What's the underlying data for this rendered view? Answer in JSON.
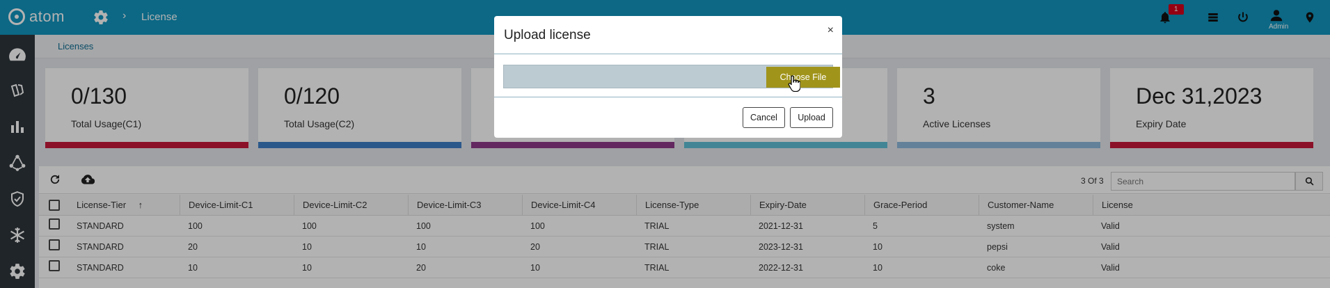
{
  "app": {
    "name": "atom",
    "breadcrumb": "License"
  },
  "topbar": {
    "notification_count": "1",
    "admin_label": "Admin"
  },
  "subheader": {
    "breadcrumb": "Licenses"
  },
  "cards": [
    {
      "value": "0/130",
      "label": "Total Usage(C1)",
      "color": "#c8193c"
    },
    {
      "value": "0/120",
      "label": "Total Usage(C2)",
      "color": "#3e7fc7"
    },
    {
      "value": "",
      "label": "",
      "color": "#8e3a89"
    },
    {
      "value": "",
      "label": "",
      "color": "#5fc0d6"
    },
    {
      "value": "3",
      "label": "Active Licenses",
      "color": "#8fb9dc"
    },
    {
      "value": "Dec 31,2023",
      "label": "Expiry Date",
      "color": "#c8193c"
    }
  ],
  "table": {
    "count": "3 Of 3",
    "search_placeholder": "Search",
    "columns": [
      "License-Tier",
      "Device-Limit-C1",
      "Device-Limit-C2",
      "Device-Limit-C3",
      "Device-Limit-C4",
      "License-Type",
      "Expiry-Date",
      "Grace-Period",
      "Customer-Name",
      "License"
    ],
    "rows": [
      [
        "STANDARD",
        "100",
        "100",
        "100",
        "100",
        "TRIAL",
        "2021-12-31",
        "5",
        "system",
        "Valid"
      ],
      [
        "STANDARD",
        "20",
        "10",
        "10",
        "20",
        "TRIAL",
        "2023-12-31",
        "10",
        "pepsi",
        "Valid"
      ],
      [
        "STANDARD",
        "10",
        "10",
        "20",
        "10",
        "TRIAL",
        "2022-12-31",
        "10",
        "coke",
        "Valid"
      ]
    ]
  },
  "modal": {
    "title": "Upload license",
    "close": "×",
    "choose_file": "Choose File",
    "cancel": "Cancel",
    "upload": "Upload"
  }
}
